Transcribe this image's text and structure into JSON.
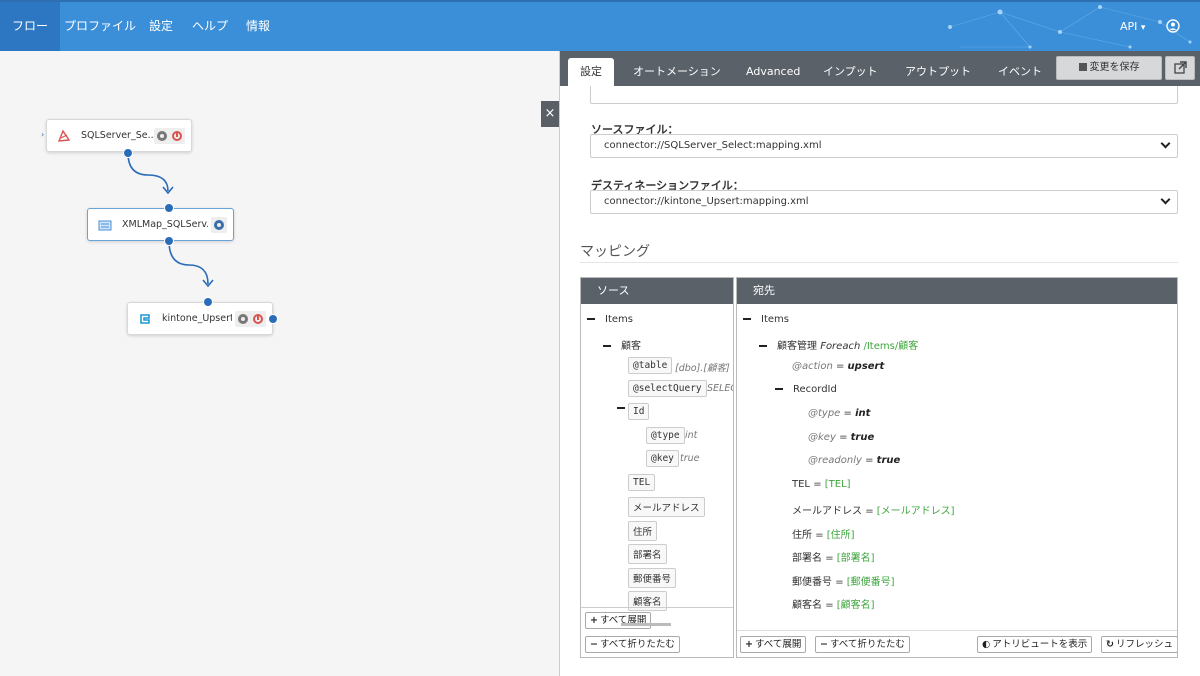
{
  "nav": {
    "items": [
      "フロー",
      "プロファイル",
      "設定",
      "ヘルプ",
      "情報"
    ],
    "api_label": "API",
    "api_caret": "▾",
    "user_icon": "user-circle-icon"
  },
  "canvas": {
    "nodes": [
      {
        "label": "SQLServer_Se...",
        "icon": "sql-server-icon"
      },
      {
        "label": "XMLMap_SQLServ...",
        "icon": "xml-map-icon"
      },
      {
        "label": "kintone_Upsert",
        "icon": "kintone-icon"
      }
    ],
    "close_glyph": "×"
  },
  "panel": {
    "tabs": [
      "設定",
      "オートメーション",
      "Advanced",
      "インプット",
      "アウトプット",
      "イベント"
    ],
    "save_label": "変更を保存",
    "source_file_label": "ソースファイル：",
    "source_file_value": "connector://SQLServer_Select:mapping.xml",
    "dest_file_label": "デスティネーションファイル：",
    "dest_file_value": "connector://kintone_Upsert:mapping.xml",
    "mapping_title": "マッピング"
  },
  "source": {
    "header": "ソース",
    "root": "Items",
    "table": "顧客",
    "table_attr": {
      "name": "@table",
      "value": "[dbo].[顧客]"
    },
    "select_attr": {
      "name": "@selectQuery",
      "value": "SELEC"
    },
    "id": "Id",
    "id_type": {
      "name": "@type",
      "value": "int"
    },
    "id_key": {
      "name": "@key",
      "value": "true"
    },
    "fields": [
      "TEL",
      "メールアドレス",
      "住所",
      "部署名",
      "郵便番号",
      "顧客名"
    ],
    "expand_all": "すべて展開",
    "collapse_all": "すべて折りたたむ"
  },
  "dest": {
    "header": "宛先",
    "root": "Items",
    "table": "顧客管理",
    "foreach_keyword": "Foreach",
    "foreach_path": "/Items/顧客",
    "action": {
      "name": "@action",
      "eq": "=",
      "value": "upsert"
    },
    "record_id": "RecordId",
    "rid_attrs": [
      {
        "name": "@type",
        "eq": "=",
        "value": "int"
      },
      {
        "name": "@key",
        "eq": "=",
        "value": "true"
      },
      {
        "name": "@readonly",
        "eq": "=",
        "value": "true"
      }
    ],
    "mappings": [
      {
        "name": "TEL",
        "eq": "=",
        "value": "[TEL]"
      },
      {
        "name": "メールアドレス",
        "eq": "=",
        "value": "[メールアドレス]"
      },
      {
        "name": "住所",
        "eq": "=",
        "value": "[住所]"
      },
      {
        "name": "部署名",
        "eq": "=",
        "value": "[部署名]"
      },
      {
        "name": "郵便番号",
        "eq": "=",
        "value": "[郵便番号]"
      },
      {
        "name": "顧客名",
        "eq": "=",
        "value": "[顧客名]"
      }
    ],
    "expand_all": "すべて展開",
    "collapse_all": "すべて折りたたむ",
    "show_attrs": "アトリビュートを表示",
    "refresh": "リフレッシュ"
  }
}
